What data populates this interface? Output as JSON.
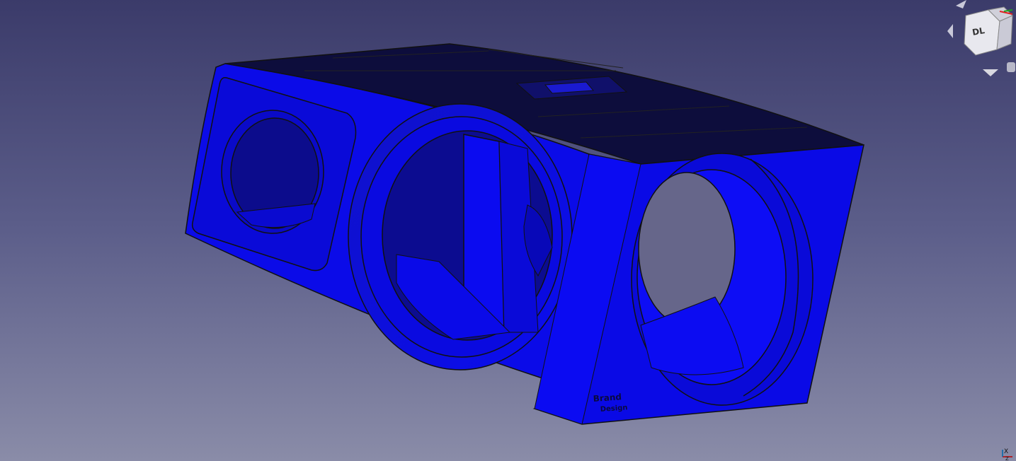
{
  "viewer": {
    "background_top": "#3b3b6a",
    "background_bottom": "#8a8ca8",
    "model_color": "#0b10e6"
  },
  "model": {
    "engraved_text_line1": "Brand",
    "engraved_text_line2": "Design"
  },
  "nav_cube": {
    "face_label": "DL"
  },
  "axis_cross": {
    "x_label": "X",
    "z_label": "Z"
  }
}
